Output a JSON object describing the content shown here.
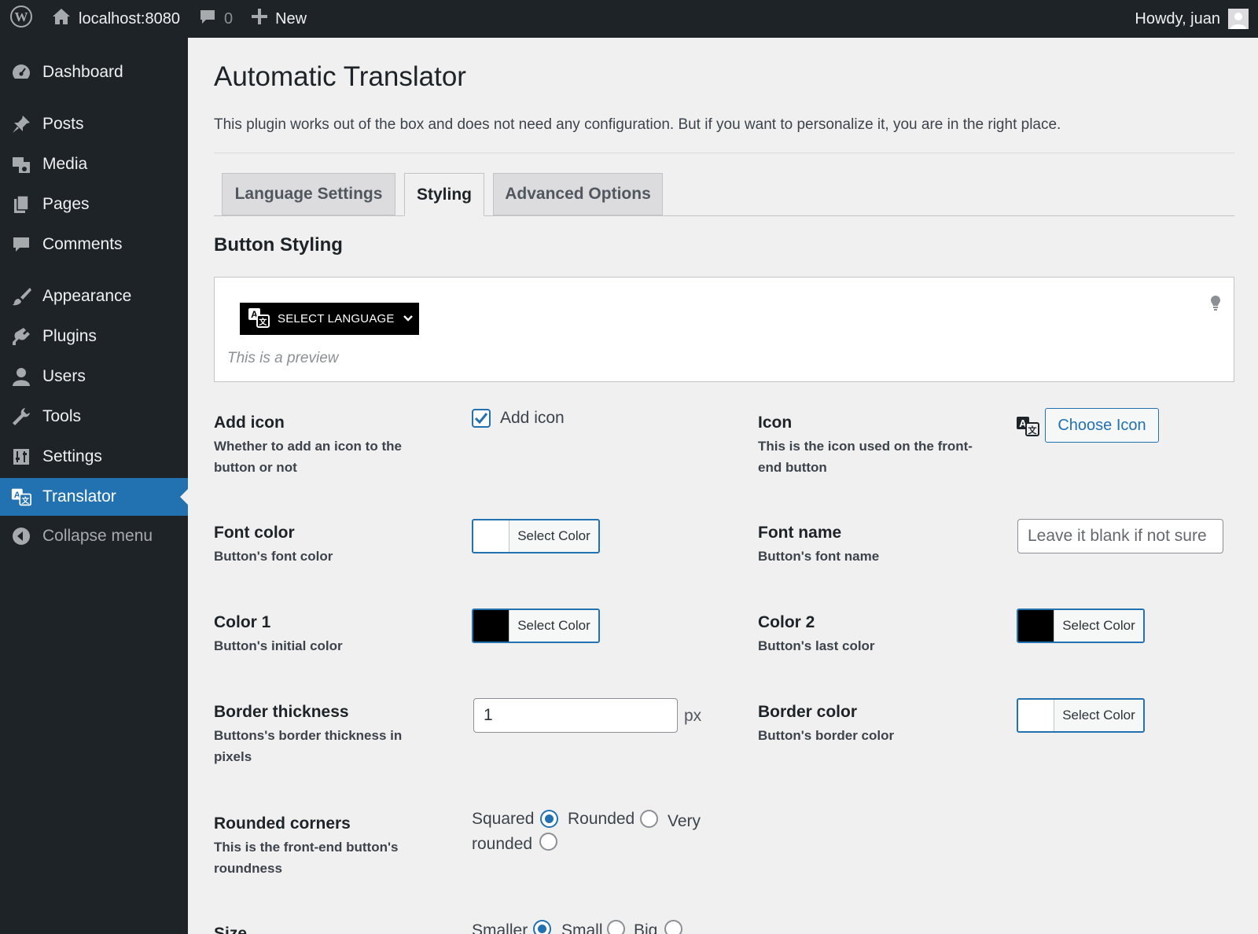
{
  "admin_bar": {
    "site": "localhost:8080",
    "comments_count": "0",
    "new_label": "New",
    "greeting": "Howdy, juan"
  },
  "sidebar": {
    "items": [
      {
        "label": "Dashboard",
        "icon": "dashboard-icon"
      },
      {
        "label": "Posts",
        "icon": "pin-icon"
      },
      {
        "label": "Media",
        "icon": "media-icon"
      },
      {
        "label": "Pages",
        "icon": "pages-icon"
      },
      {
        "label": "Comments",
        "icon": "comment-icon"
      },
      {
        "label": "Appearance",
        "icon": "brush-icon"
      },
      {
        "label": "Plugins",
        "icon": "plug-icon"
      },
      {
        "label": "Users",
        "icon": "user-icon"
      },
      {
        "label": "Tools",
        "icon": "wrench-icon"
      },
      {
        "label": "Settings",
        "icon": "settings-icon"
      },
      {
        "label": "Translator",
        "icon": "translate-icon",
        "active": true
      },
      {
        "label": "Collapse menu",
        "icon": "collapse-icon"
      }
    ]
  },
  "page": {
    "title": "Automatic Translator",
    "intro": "This plugin works out of the box and does not need any configuration. But if you want to personalize it, you are in the right place."
  },
  "tabs": [
    {
      "label": "Language Settings"
    },
    {
      "label": "Styling",
      "active": true
    },
    {
      "label": "Advanced Options"
    }
  ],
  "section": {
    "title": "Button Styling",
    "preview_button": "SELECT LANGUAGE",
    "preview_caption": "This is a preview"
  },
  "fields": {
    "add_icon": {
      "label": "Add icon",
      "desc": "Whether to add an icon to the button or not",
      "checkbox_label": "Add icon",
      "checked": true
    },
    "icon": {
      "label": "Icon",
      "desc": "This is the icon used on the front-end button",
      "button": "Choose Icon"
    },
    "font_color": {
      "label": "Font color",
      "desc": "Button's font color",
      "button": "Select Color",
      "color": "#ffffff"
    },
    "font_name": {
      "label": "Font name",
      "desc": "Button's font name",
      "placeholder": "Leave it blank if not sure"
    },
    "color1": {
      "label": "Color 1",
      "desc": "Button's initial color",
      "button": "Select Color",
      "color": "#000000"
    },
    "color2": {
      "label": "Color 2",
      "desc": "Button's last color",
      "button": "Select Color",
      "color": "#000000"
    },
    "border_thickness": {
      "label": "Border thickness",
      "desc": "Buttons's border thickness in pixels",
      "value": "1",
      "unit": "px"
    },
    "border_color": {
      "label": "Border color",
      "desc": "Button's border color",
      "button": "Select Color",
      "color": "#ffffff"
    },
    "rounded": {
      "label": "Rounded corners",
      "desc": "This is the front-end button's roundness",
      "options": [
        "Squared",
        "Rounded",
        "Very rounded"
      ],
      "selected": "Squared"
    },
    "size": {
      "label": "Size",
      "options": [
        "Smaller",
        "Small",
        "Big"
      ],
      "selected": "Smaller"
    }
  },
  "colors": {
    "accent": "#2271b1",
    "adminbar": "#1d2327",
    "background": "#f0f0f1"
  }
}
